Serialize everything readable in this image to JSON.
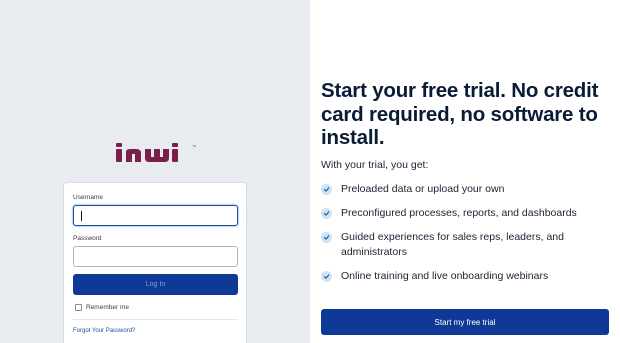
{
  "brand": {
    "logo_icon": "inwi-logo",
    "logo_color": "#7a1f4a",
    "trademark": "™"
  },
  "login": {
    "username_label": "Username",
    "username_value": "",
    "password_label": "Password",
    "password_value": "",
    "login_button": "Log In",
    "remember_me": "Remember me",
    "remember_checked": false,
    "forgot_link": "Forgot Your Password?"
  },
  "promo": {
    "headline": "Start your free trial. No credit card required, no software to install.",
    "subhead": "With your trial, you get:",
    "bullets": [
      "Preloaded data or upload your own",
      "Preconfigured processes, reports, and dashboards",
      "Guided experiences for sales reps, leaders, and administrators",
      "Online training and live onboarding webinars"
    ],
    "cta_button": "Start my free trial",
    "accent_color": "#0f3996"
  }
}
